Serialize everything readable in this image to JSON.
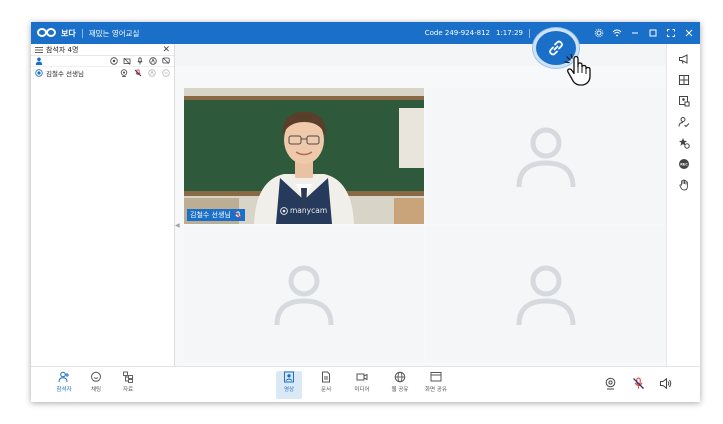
{
  "titlebar": {
    "app_name": "보다",
    "class_name": "재밌는 영어교실",
    "code": "Code 249-924-812",
    "time": "1:17:29"
  },
  "participants": {
    "header": "참석자 4명",
    "list": [
      {
        "name": "김철수 선생님"
      }
    ]
  },
  "stage": {
    "presenter_name": "김철수 선생님",
    "camera_watermark": "manycam"
  },
  "bottom_bar": {
    "left": [
      {
        "label": "참석자",
        "icon": "participants-icon"
      },
      {
        "label": "채팅",
        "icon": "chat-icon"
      },
      {
        "label": "자료",
        "icon": "files-icon"
      }
    ],
    "center": [
      {
        "label": "영상",
        "icon": "video-share-icon"
      },
      {
        "label": "문서",
        "icon": "document-icon"
      },
      {
        "label": "미디어",
        "icon": "media-icon"
      },
      {
        "label": "웹 공유",
        "icon": "web-share-icon"
      },
      {
        "label": "화면 공유",
        "icon": "screen-share-icon"
      }
    ]
  },
  "colors": {
    "brand": "#1a6fc8",
    "mute_red": "#e0443a"
  }
}
